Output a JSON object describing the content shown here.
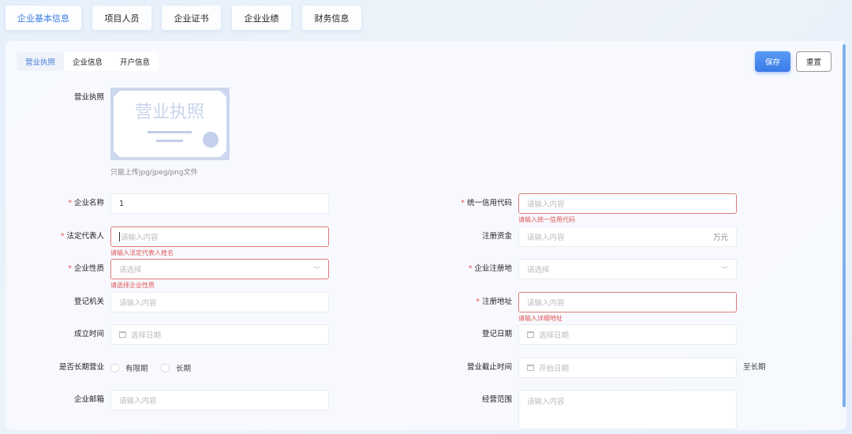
{
  "top_tabs": [
    {
      "label": "企业基本信息",
      "active": true
    },
    {
      "label": "项目人员"
    },
    {
      "label": "企业证书"
    },
    {
      "label": "企业业绩"
    },
    {
      "label": "财务信息"
    }
  ],
  "sub_tabs": [
    {
      "label": "营业执照",
      "active": true
    },
    {
      "label": "企业信息"
    },
    {
      "label": "开户信息"
    }
  ],
  "actions": {
    "save": "保存",
    "reset": "重置"
  },
  "license": {
    "label": "营业执照",
    "image_text": "营业执照",
    "hint": "只能上传jpg/jpeg/png文件"
  },
  "colors": {
    "accent": "#3d7be0",
    "error": "#e05555"
  },
  "left_fields": [
    {
      "label": "企业名称",
      "required": true,
      "type": "text",
      "value": "1",
      "placeholder": ""
    },
    {
      "label": "法定代表人",
      "required": true,
      "type": "text",
      "value": "",
      "placeholder": "请输入内容",
      "error": "请输入法定代表人姓名",
      "focused": true
    },
    {
      "label": "企业性质",
      "required": true,
      "type": "select",
      "placeholder": "请选择",
      "error": "请选择企业性质"
    },
    {
      "label": "登记机关",
      "type": "text",
      "placeholder": "请输入内容"
    },
    {
      "label": "成立时间",
      "type": "date",
      "placeholder": "选择日期"
    },
    {
      "label": "是否长期营业",
      "type": "radio",
      "options": [
        "有限期",
        "长期"
      ]
    },
    {
      "label": "企业邮箱",
      "type": "text",
      "placeholder": "请输入内容"
    }
  ],
  "right_fields": [
    {
      "label": "统一信用代码",
      "required": true,
      "type": "text",
      "placeholder": "请输入内容",
      "error": "请输入统一信用代码"
    },
    {
      "label": "注册资金",
      "type": "text",
      "placeholder": "请输入内容",
      "suffix": "万元"
    },
    {
      "label": "企业注册地",
      "required": true,
      "type": "select",
      "placeholder": "请选择"
    },
    {
      "label": "注册地址",
      "required": true,
      "type": "text",
      "placeholder": "请输入内容",
      "error": "请输入详细地址"
    },
    {
      "label": "登记日期",
      "type": "date",
      "placeholder": "选择日期"
    },
    {
      "label": "营业截止时间",
      "type": "date",
      "placeholder": "开始日期",
      "after": "至长期"
    },
    {
      "label": "经营范围",
      "type": "textarea",
      "placeholder": "请输入内容"
    }
  ]
}
